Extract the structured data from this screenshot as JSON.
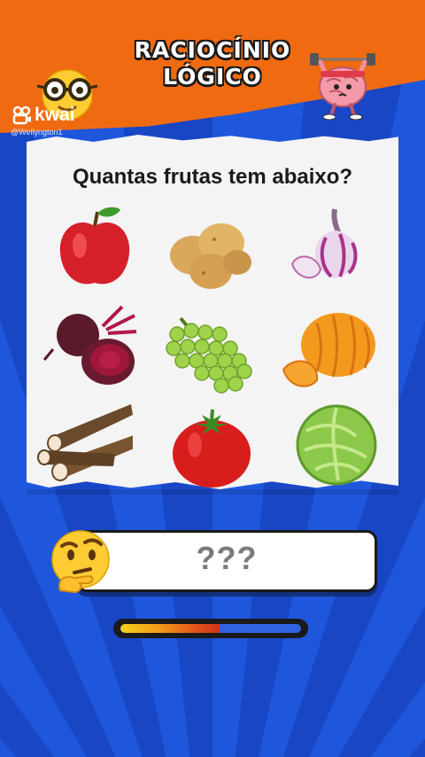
{
  "header": {
    "title_line1": "RACIOCÍNIO",
    "title_line2": "LÓGICO",
    "brand": "kwai",
    "handle": "@Wellyngton1"
  },
  "puzzle": {
    "question": "Quantas frutas tem abaixo?",
    "items": [
      {
        "name": "apple-icon"
      },
      {
        "name": "potato-icon"
      },
      {
        "name": "garlic-icon"
      },
      {
        "name": "beet-icon"
      },
      {
        "name": "grapes-icon"
      },
      {
        "name": "tangerine-icon"
      },
      {
        "name": "cassava-icon"
      },
      {
        "name": "tomato-icon"
      },
      {
        "name": "cabbage-icon"
      }
    ]
  },
  "answer": {
    "placeholder": "???"
  },
  "timer": {
    "progress": 0.55
  },
  "colors": {
    "header_orange": "#f06a12",
    "background_blue": "#1b4fd0",
    "paper": "#f4f4f4"
  }
}
